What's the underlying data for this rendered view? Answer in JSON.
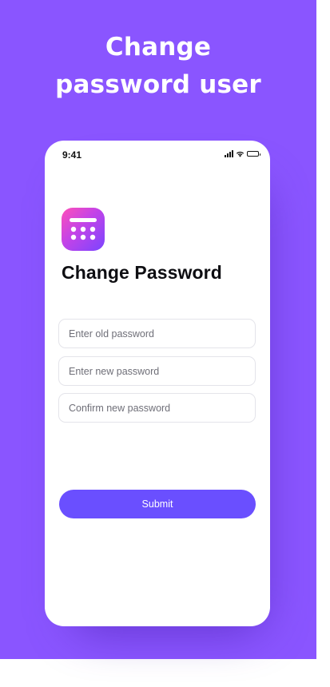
{
  "headline": {
    "line1": "Change",
    "line2": "password user"
  },
  "status_bar": {
    "time": "9:41",
    "icons": [
      "signal-icon",
      "wifi-icon",
      "battery-icon"
    ]
  },
  "app": {
    "logo_icon": "app-logo-icon",
    "title": "Change Password"
  },
  "form": {
    "old_password_placeholder": "Enter old password",
    "new_password_placeholder": "Enter new password",
    "confirm_password_placeholder": "Confirm new password",
    "submit_label": "Submit"
  },
  "colors": {
    "background": "#8a55ff",
    "button": "#6a4fff",
    "logo_gradient_start": "#ff4fb8",
    "logo_gradient_end": "#7a45ff"
  }
}
